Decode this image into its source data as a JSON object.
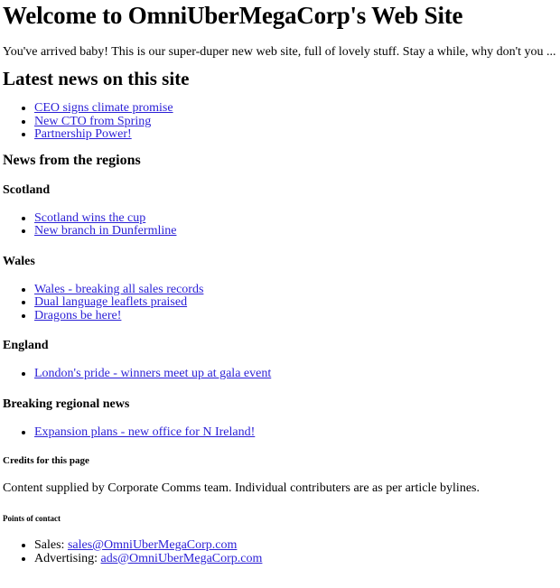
{
  "page": {
    "title": "Welcome to OmniUberMegaCorp's Web Site",
    "intro": "You've arrived baby! This is our super-duper new web site, full of lovely stuff. Stay a while, why don't you ..."
  },
  "latest": {
    "heading": "Latest news on this site",
    "items": [
      "CEO signs climate promise",
      "New CTO from Spring",
      "Partnership Power!"
    ]
  },
  "regions": {
    "heading": "News from the regions",
    "scotland": {
      "heading": "Scotland",
      "items": [
        "Scotland wins the cup",
        "New branch in Dunfermline"
      ]
    },
    "wales": {
      "heading": "Wales",
      "items": [
        "Wales - breaking all sales records",
        "Dual language leaflets praised",
        "Dragons be here!"
      ]
    },
    "england": {
      "heading": "England",
      "items": [
        "London's pride - winners meet up at gala event"
      ]
    },
    "breaking": {
      "heading": "Breaking regional news",
      "items": [
        "Expansion plans - new office for N Ireland!"
      ]
    }
  },
  "credits": {
    "heading": "Credits for this page",
    "text": "Content supplied by Corporate Comms team. Individual contributers are as per article bylines."
  },
  "contact": {
    "heading": "Points of contact",
    "items": [
      {
        "label": "Sales: ",
        "email": "sales@OmniUberMegaCorp.com"
      },
      {
        "label": "Advertising: ",
        "email": "ads@OmniUberMegaCorp.com"
      }
    ]
  }
}
